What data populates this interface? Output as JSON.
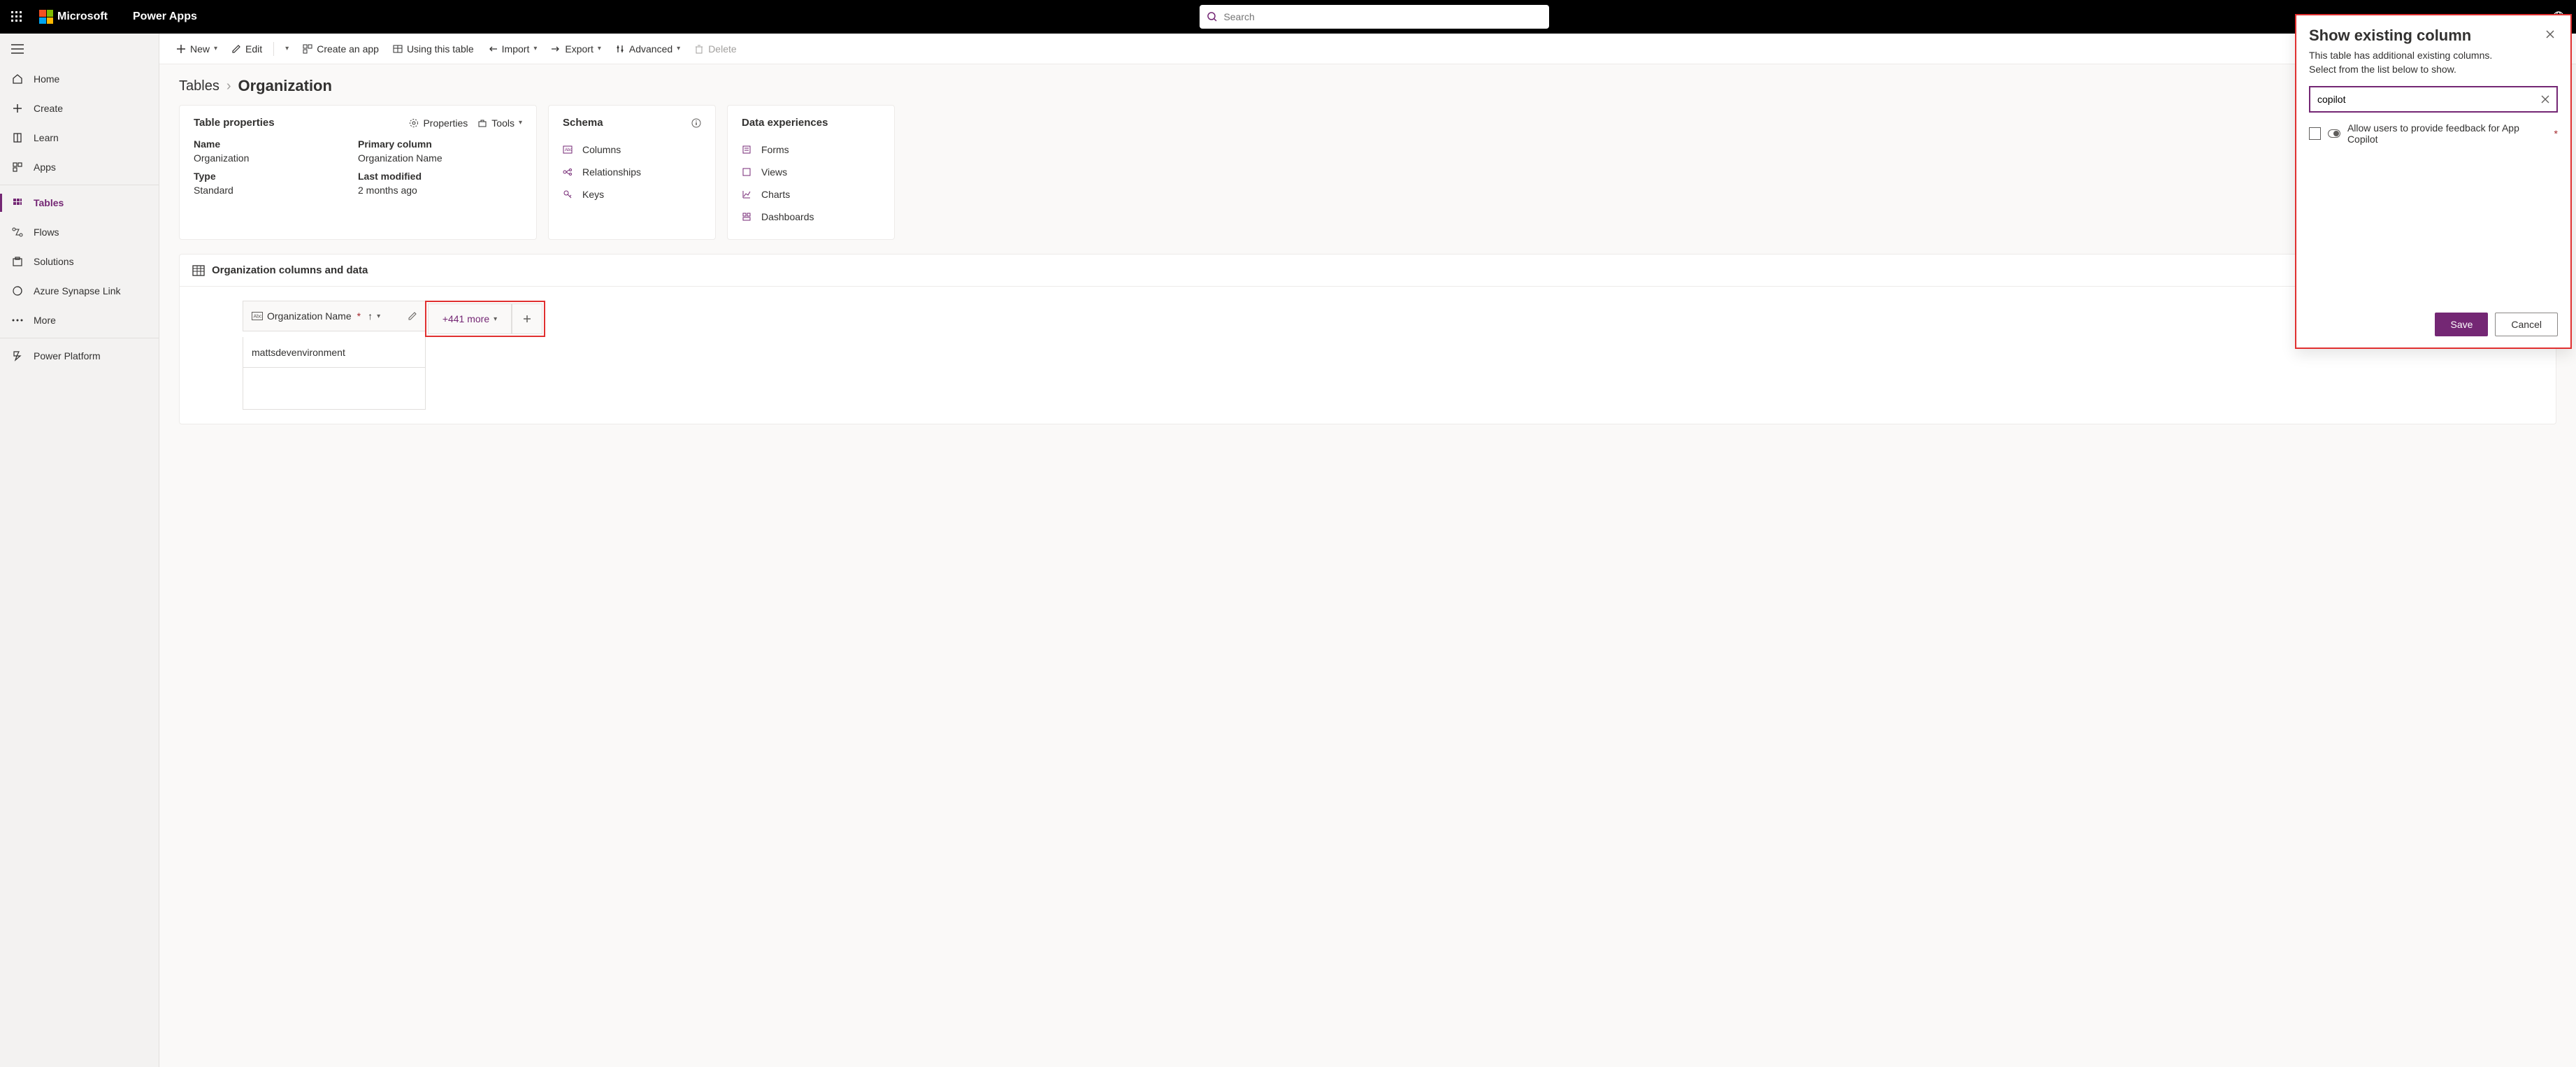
{
  "header": {
    "brand": "Microsoft",
    "app": "Power Apps",
    "search_placeholder": "Search"
  },
  "nav": {
    "items": [
      {
        "icon": "home",
        "label": "Home"
      },
      {
        "icon": "plus",
        "label": "Create"
      },
      {
        "icon": "book",
        "label": "Learn"
      },
      {
        "icon": "apps",
        "label": "Apps"
      },
      {
        "icon": "grid",
        "label": "Tables",
        "active": true
      },
      {
        "icon": "flow",
        "label": "Flows"
      },
      {
        "icon": "solution",
        "label": "Solutions"
      },
      {
        "icon": "synapse",
        "label": "Azure Synapse Link"
      },
      {
        "icon": "more",
        "label": "More"
      },
      {
        "icon": "platform",
        "label": "Power Platform"
      }
    ]
  },
  "cmdbar": {
    "new": "New",
    "edit": "Edit",
    "create_app": "Create an app",
    "using_table": "Using this table",
    "import": "Import",
    "export": "Export",
    "advanced": "Advanced",
    "delete": "Delete"
  },
  "crumbs": {
    "root": "Tables",
    "current": "Organization"
  },
  "props": {
    "title": "Table properties",
    "properties_label": "Properties",
    "tools_label": "Tools",
    "name_label": "Name",
    "name_value": "Organization",
    "primary_label": "Primary column",
    "primary_value": "Organization Name",
    "type_label": "Type",
    "type_value": "Standard",
    "modified_label": "Last modified",
    "modified_value": "2 months ago"
  },
  "schema": {
    "title": "Schema",
    "items": [
      "Columns",
      "Relationships",
      "Keys"
    ]
  },
  "dexp": {
    "title": "Data experiences",
    "items": [
      "Forms",
      "Views",
      "Charts",
      "Dashboards"
    ]
  },
  "grid": {
    "title": "Organization columns and data",
    "col_name": "Organization Name",
    "more": "+441 more",
    "row1": "mattsdevenvironment"
  },
  "panel": {
    "title": "Show existing column",
    "desc1": "This table has additional existing columns.",
    "desc2": "Select from the list below to show.",
    "search_value": "copilot",
    "option": "Allow users to provide feedback for App Copilot",
    "save": "Save",
    "cancel": "Cancel"
  }
}
